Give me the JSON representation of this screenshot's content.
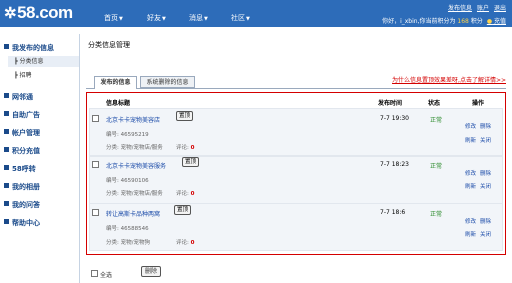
{
  "brand": {
    "logo": "58.com",
    "logo_symbol": "✲"
  },
  "nav": [
    {
      "label": "首页"
    },
    {
      "label": "好友"
    },
    {
      "label": "消息"
    },
    {
      "label": "社区"
    }
  ],
  "userlinks": [
    "发布信息",
    "账户",
    "退出"
  ],
  "userinfo": {
    "text": "你好，i_xbin,你当前积分为",
    "points": "168",
    "unit": "积分",
    "pay": "充值"
  },
  "sidebar": {
    "sections": [
      {
        "label": "我发布的信息",
        "subs": [
          "分类信息",
          "招聘"
        ]
      },
      {
        "label": "网邻通"
      },
      {
        "label": "自助广告"
      },
      {
        "label": "帐户管理"
      },
      {
        "label": "积分充值"
      },
      {
        "label": "58呼转"
      },
      {
        "label": "我的相册"
      },
      {
        "label": "我的问答"
      },
      {
        "label": "帮助中心"
      }
    ]
  },
  "page_title": "分类信息管理",
  "tabs": [
    {
      "label": "发布的信息"
    },
    {
      "label": "系统删除的信息"
    }
  ],
  "help_link": "为什么信息置顶效果差呀,点击了解详情>>",
  "table": {
    "headers": [
      "信息标题",
      "发布时间",
      "状态",
      "操作"
    ],
    "rows": [
      {
        "title": "北京卡卡宠物美容店",
        "button": "置顶",
        "id_label": "编号: 46595219",
        "category": "分类: 宠物/宠物店/服务",
        "comment_label": "评论:",
        "comment_count": "0",
        "time": "7-7 19:30",
        "status": "正常",
        "ops": [
          "修改",
          "删除",
          "刷新",
          "关闭"
        ]
      },
      {
        "title": "北京卡卡宠物美容服务",
        "button": "置顶",
        "id_label": "编号: 46590106",
        "category": "分类: 宠物/宠物店/服务",
        "comment_label": "评论:",
        "comment_count": "0",
        "time": "7-7 18:23",
        "status": "正常",
        "ops": [
          "修改",
          "删除",
          "刷新",
          "关闭"
        ]
      },
      {
        "title": "转让高斯卡品种两窝",
        "button": "置顶",
        "id_label": "编号: 46588546",
        "category": "分类: 宠物/宠物狗",
        "comment_label": "评论:",
        "comment_count": "0",
        "time": "7-7 18:6",
        "status": "正常",
        "ops": [
          "修改",
          "删除",
          "刷新",
          "关闭"
        ]
      }
    ]
  },
  "footer": {
    "select_all": "全选",
    "delete": "删除"
  },
  "colors": {
    "topbar": "#2d6cb9",
    "link": "#1a4aa8",
    "alert": "#d40000",
    "ok": "#2a8a2a"
  }
}
